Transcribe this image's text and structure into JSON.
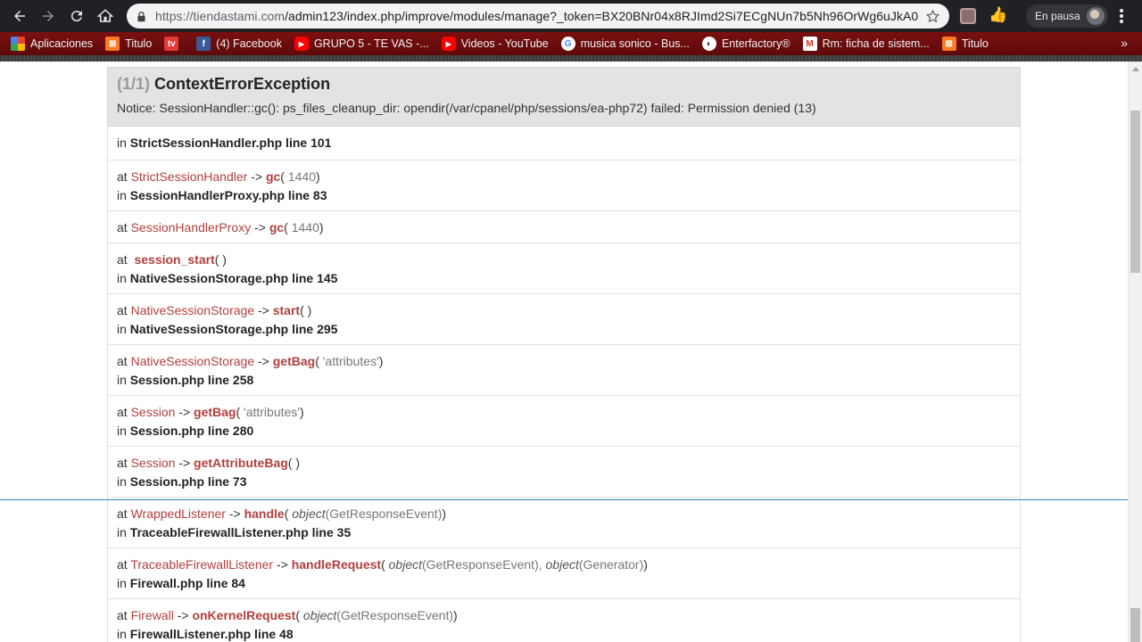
{
  "browser": {
    "url_host": "https://tiendastami.com",
    "url_path": "/admin123/index.php/improve/modules/manage?_token=BX20BNr04x8RJImd2Si7ECgNUn7b5Nh96OrWg6uJkA0",
    "profile_label": "En pausa"
  },
  "bookmarks": [
    {
      "label": "Aplicaciones",
      "icon": "apps-grid-icon",
      "color": "#f4b400"
    },
    {
      "label": "Titulo",
      "icon": "xampp-icon",
      "color": "#fb7a24"
    },
    {
      "label": "",
      "icon": "tv-icon",
      "color": "#e53935"
    },
    {
      "label": "(4) Facebook",
      "icon": "facebook-icon",
      "color": "#3b5998"
    },
    {
      "label": "GRUPO 5 - TE VAS -...",
      "icon": "youtube-icon",
      "color": "#ff0000"
    },
    {
      "label": "Videos - YouTube",
      "icon": "youtube-icon",
      "color": "#ff0000"
    },
    {
      "label": "musica sonico - Bus...",
      "icon": "google-icon",
      "color": "#ffffff"
    },
    {
      "label": "Enterfactory®",
      "icon": "globe-icon",
      "color": "#ffffff"
    },
    {
      "label": "Rm: ficha de sistem...",
      "icon": "gmail-icon",
      "color": "#ffffff"
    },
    {
      "label": "Titulo",
      "icon": "xampp-icon",
      "color": "#fb7a24"
    }
  ],
  "exception": {
    "count": "(1/1)",
    "name": "ContextErrorException",
    "message": "Notice: SessionHandler::gc(): ps_files_cleanup_dir: opendir(/var/cpanel/php/sessions/ea-php72) failed: Permission denied (13)"
  },
  "trace": {
    "r0": {
      "in": "in ",
      "file": "StrictSessionHandler.php line 101"
    },
    "r1": {
      "at": "at ",
      "cls": "StrictSessionHandler",
      "arrow": " -> ",
      "fn": "gc",
      "open": "( ",
      "arg": "1440",
      "close": ")",
      "in": "in ",
      "file": "SessionHandlerProxy.php line 83"
    },
    "r2": {
      "at": "at ",
      "cls": "SessionHandlerProxy",
      "arrow": " -> ",
      "fn": "gc",
      "open": "( ",
      "arg": "1440",
      "close": ")"
    },
    "r3": {
      "at": "at  ",
      "fn": "session_start",
      "call": "( )",
      "in": "in ",
      "file": "NativeSessionStorage.php line 145"
    },
    "r4": {
      "at": "at ",
      "cls": "NativeSessionStorage",
      "arrow": " -> ",
      "fn": "start",
      "call": "( )",
      "in": "in ",
      "file": "NativeSessionStorage.php line 295"
    },
    "r5": {
      "at": "at ",
      "cls": "NativeSessionStorage",
      "arrow": " -> ",
      "fn": "getBag",
      "open": "( ",
      "arg": "'attributes'",
      "close": ")",
      "in": "in ",
      "file": "Session.php line 258"
    },
    "r6": {
      "at": "at ",
      "cls": "Session",
      "arrow": " -> ",
      "fn": "getBag",
      "open": "( ",
      "arg": "'attributes'",
      "close": ")",
      "in": "in ",
      "file": "Session.php line 280"
    },
    "r7": {
      "at": "at ",
      "cls": "Session",
      "arrow": " -> ",
      "fn": "getAttributeBag",
      "call": "( )",
      "in": "in ",
      "file": "Session.php line 73"
    },
    "r8": {
      "at": "at ",
      "cls": "WrappedListener",
      "arrow": " -> ",
      "fn": "handle",
      "open": "( ",
      "obj1": "object",
      "arg1": "(GetResponseEvent)",
      "close": ")",
      "in": "in ",
      "file": "TraceableFirewallListener.php line 35"
    },
    "r9": {
      "at": "at ",
      "cls": "TraceableFirewallListener",
      "arrow": " -> ",
      "fn": "handleRequest",
      "open": "( ",
      "obj1": "object",
      "arg1": "(GetResponseEvent), ",
      "obj2": "object",
      "arg2": "(Generator)",
      "close": ")",
      "in": "in ",
      "file": "Firewall.php line 84"
    },
    "r10": {
      "at": "at ",
      "cls": "Firewall",
      "arrow": " -> ",
      "fn": "onKernelRequest",
      "open": "( ",
      "obj1": "object",
      "arg1": "(GetResponseEvent)",
      "close": ")",
      "in": "in ",
      "file": "FirewallListener.php line 48"
    }
  }
}
